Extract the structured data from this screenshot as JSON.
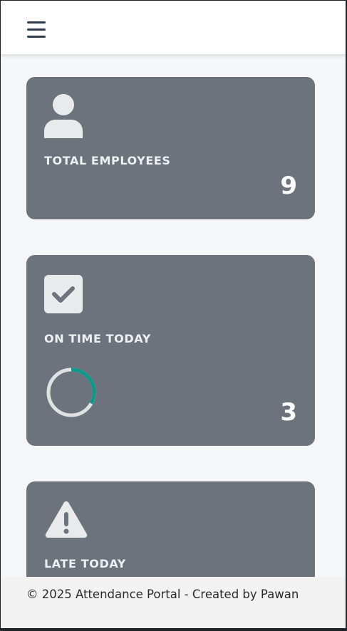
{
  "header": {
    "menu_icon": "hamburger-menu-icon"
  },
  "cards": [
    {
      "icon": "user-icon",
      "label": "TOTAL EMPLOYEES",
      "value": "9"
    },
    {
      "icon": "checkbox-check-icon",
      "label": "ON TIME TODAY",
      "value": "3",
      "progress_fraction": 0.33,
      "progress_color": "#0b9a8a"
    },
    {
      "icon": "warning-triangle-icon",
      "label": "LATE TODAY"
    }
  ],
  "colors": {
    "card_bg": "#6c737d",
    "accent": "#0b9a8a"
  },
  "footer": {
    "text": "© 2025 Attendance Portal - Created by Pawan"
  }
}
